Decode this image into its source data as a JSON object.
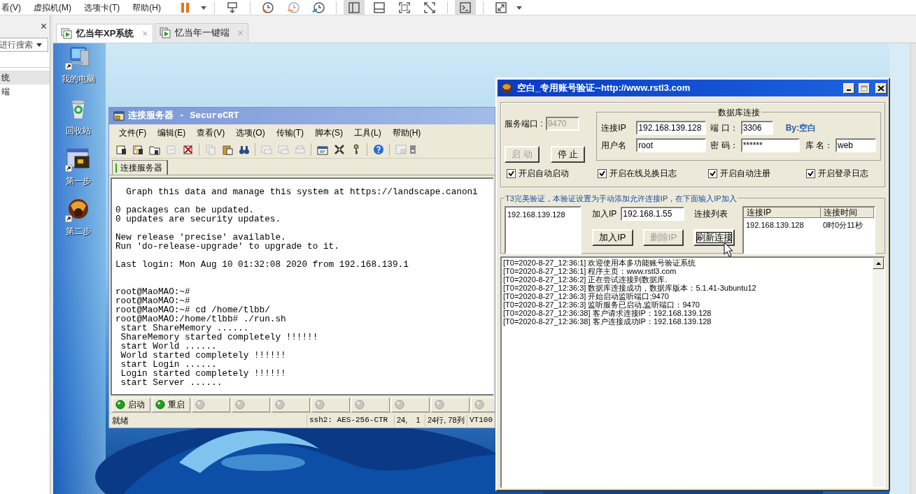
{
  "host": {
    "menu": [
      "看(V)",
      "虚拟机(M)",
      "选项卡(T)",
      "帮助(H)"
    ],
    "library": {
      "close": "×",
      "search_placeholder": "进行搜索",
      "items": [
        {
          "label": "统",
          "selected": true
        },
        {
          "label": "端",
          "selected": false
        }
      ]
    },
    "tabs": [
      {
        "label": "忆当年XP系统",
        "selected": true,
        "close": "×"
      },
      {
        "label": "忆当年一键端",
        "selected": false,
        "close": "×"
      }
    ]
  },
  "desktop": {
    "icons": [
      {
        "label": "我的电脑",
        "kind": "computer"
      },
      {
        "label": "回收站",
        "kind": "recycle"
      },
      {
        "label": "第一步",
        "kind": "app"
      },
      {
        "label": "第二步",
        "kind": "game"
      }
    ]
  },
  "securecrt": {
    "title": "连接服务器 - SecureCRT",
    "menu": [
      "文件(F)",
      "编辑(E)",
      "查看(V)",
      "选项(O)",
      "传输(T)",
      "脚本(S)",
      "工具(L)",
      "帮助(H)"
    ],
    "session_tab": "连接服务器",
    "terminal": [
      [
        "  Graph this data and manage this system at https://landscape.canoni"
      ],
      [
        "0 packages can be updated.",
        "0 updates are security updates."
      ],
      [
        "New release 'precise' available.",
        "Run 'do-release-upgrade' to upgrade to it."
      ],
      [
        "Last login: Mon Aug 10 01:32:08 2020 from 192.168.139.1"
      ],
      [
        "root@MaoMAO:~#",
        "root@MaoMAO:~#",
        "root@MaoMAO:~# cd /home/tlbb/",
        "root@MaoMAO:/home/tlbb# ./run.sh",
        " start ShareMemory ......",
        " ShareMemory started completely !!!!!!",
        " start World ......",
        " World started completely !!!!!!",
        " start Login ......",
        " Login started completely !!!!!!",
        " start Server ......"
      ]
    ],
    "buttons": [
      {
        "label": "启动",
        "on": true
      },
      {
        "label": "重启",
        "on": true
      },
      {
        "on": false
      },
      {
        "on": false
      },
      {
        "on": false
      },
      {
        "on": false
      },
      {
        "on": false
      },
      {
        "on": false
      },
      {
        "on": false
      },
      {
        "on": false
      }
    ],
    "status": [
      "就绪",
      "ssh2: AES-256-CTR",
      "24,    1",
      "24行, 78列",
      "VT100"
    ]
  },
  "dialog": {
    "title": "空白_专用账号验证--http://www.rstl3.com",
    "service_port": {
      "label": "服务端口 :",
      "value": "9470",
      "disabled": true
    },
    "start_button": {
      "label": "启 动",
      "disabled": true
    },
    "stop_button": {
      "label": "停 止",
      "disabled": false
    },
    "db": {
      "legend": "数据库连接",
      "ip": {
        "label": "连接IP",
        "value": "192.168.139.128"
      },
      "port": {
        "label": "端 口：",
        "value": "3306"
      },
      "credit": "By:空白",
      "user": {
        "label": "用户名",
        "value": "root"
      },
      "password": {
        "label": "密 码：",
        "value": "******"
      },
      "database": {
        "label": "库 名：",
        "value": "web"
      }
    },
    "checkboxes": [
      {
        "label": "开启自动启动",
        "checked": true
      },
      {
        "label": "开启在线兑换日志",
        "checked": true
      },
      {
        "label": "开启自动注册",
        "checked": true
      },
      {
        "label": "开启登录日志",
        "checked": true
      }
    ],
    "whitelist": {
      "legend": "T3完美验证，本验证设置为手动添加允许连接IP，在下面输入IP加入",
      "ips": [
        "192.168.139.128"
      ],
      "add_label": "加入IP",
      "add_value": "192.168.1.55",
      "list_label": "连接列表",
      "buttons": [
        {
          "label": "加入IP",
          "disabled": false,
          "focused": false
        },
        {
          "label": "删除IP",
          "disabled": true,
          "focused": false
        },
        {
          "label": "刷新连接",
          "disabled": false,
          "focused": true
        }
      ],
      "table": {
        "columns": [
          "连接IP",
          "连接时间"
        ],
        "rows": [
          [
            "192.168.139.128",
            "0时0分11秒"
          ]
        ]
      }
    },
    "log": [
      "[T0=2020-8-27_12:36:1] 欢迎使用本多功能账号验证系统",
      "[T0=2020-8-27_12:36:1] 程序主页：www.rstl3.com",
      "[T0=2020-8-27_12:36:2] 正在尝试连接到数据库.",
      "[T0=2020-8-27_12:36:3] 数据库连接成功，数据库版本：5.1.41-3ubuntu12",
      "[T0=2020-8-27_12:36:3] 开始启动监听端口;9470",
      "[T0=2020-8-27_12:36:3] 监听服务已启动,监听端口：9470",
      "[T0=2020-8-27_12:36:38] 客户请求连接IP：192.168.139.128",
      "[T0=2020-8-27_12:36:38] 客户连接成功IP：192.168.139.128"
    ]
  }
}
